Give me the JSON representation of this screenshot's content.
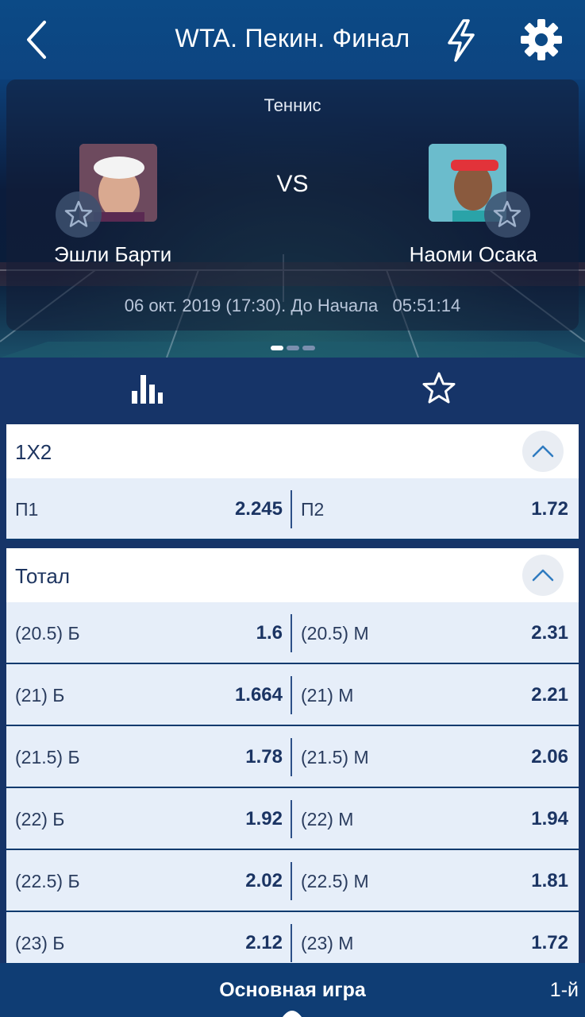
{
  "header": {
    "title": "WTA. Пекин. Финал",
    "icons": [
      "back-icon",
      "lightning-icon",
      "gear-icon"
    ]
  },
  "match": {
    "sport": "Теннис",
    "vs": "VS",
    "player1": "Эшли Барти",
    "player2": "Наоми Осака",
    "datetime": "06 окт. 2019 (17:30). До Начала   05:51:14",
    "pager": {
      "pages": 3,
      "active": 1
    }
  },
  "tabs_icons": [
    "stats-icon",
    "star-icon"
  ],
  "markets": [
    {
      "title": "1X2",
      "rows": [
        {
          "left_label": "П1",
          "left_value": "2.245",
          "right_label": "П2",
          "right_value": "1.72"
        }
      ]
    },
    {
      "title": "Тотал",
      "rows": [
        {
          "left_label": "(20.5) Б",
          "left_value": "1.6",
          "right_label": "(20.5) М",
          "right_value": "2.31"
        },
        {
          "left_label": "(21) Б",
          "left_value": "1.664",
          "right_label": "(21) М",
          "right_value": "2.21"
        },
        {
          "left_label": "(21.5) Б",
          "left_value": "1.78",
          "right_label": "(21.5) М",
          "right_value": "2.06"
        },
        {
          "left_label": "(22) Б",
          "left_value": "1.92",
          "right_label": "(22) М",
          "right_value": "1.94"
        },
        {
          "left_label": "(22.5) Б",
          "left_value": "2.02",
          "right_label": "(22.5) М",
          "right_value": "1.81"
        },
        {
          "left_label": "(23) Б",
          "left_value": "2.12",
          "right_label": "(23) М",
          "right_value": "1.72"
        }
      ]
    }
  ],
  "bottom": {
    "main_tab": "Основная игра",
    "set_tab": "1-й"
  },
  "colors": {
    "header_bg": "#0c4a86",
    "page_bg": "#163468",
    "odds_row_bg": "#e6eef9",
    "odds_text": "#1b3463"
  }
}
